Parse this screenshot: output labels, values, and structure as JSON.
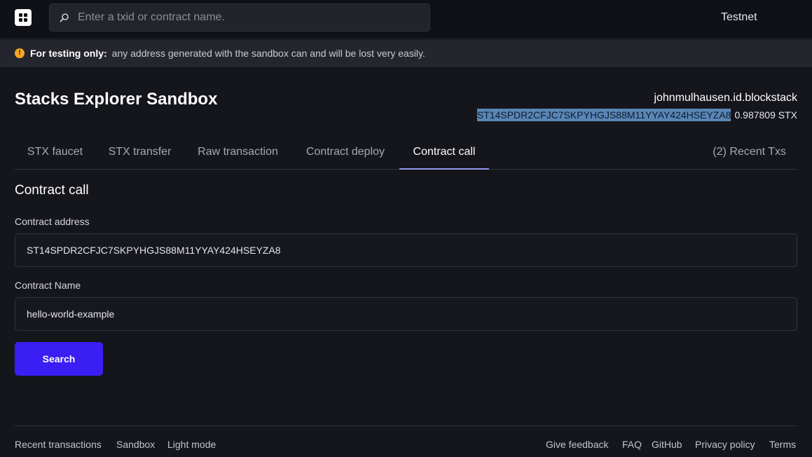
{
  "header": {
    "search_placeholder": "Enter a txid or contract name.",
    "network_label": "Testnet"
  },
  "banner": {
    "bold": "For testing only:",
    "message": "any address generated with the sandbox can and will be lost very easily."
  },
  "page": {
    "title": "Stacks Explorer Sandbox",
    "account_name": "johnmulhausen.id.blockstack",
    "account_address": "ST14SPDR2CFJC7SKPYHGJS88M11YYAY424HSEYZA8",
    "account_balance": "0.987809 STX"
  },
  "tabs": [
    {
      "label": "STX faucet"
    },
    {
      "label": "STX transfer"
    },
    {
      "label": "Raw transaction"
    },
    {
      "label": "Contract deploy"
    },
    {
      "label": "Contract call",
      "active": true
    }
  ],
  "recent_txs": "(2) Recent Txs",
  "form": {
    "section_title": "Contract call",
    "address_label": "Contract address",
    "address_value": "ST14SPDR2CFJC7SKPYHGJS88M11YYAY424HSEYZA8",
    "name_label": "Contract Name",
    "name_value": "hello-world-example",
    "submit_label": "Search"
  },
  "footer": {
    "left": [
      "Recent transactions",
      "Sandbox",
      "Light mode"
    ],
    "right": [
      "Give feedback",
      "FAQ",
      "GitHub",
      "Privacy policy",
      "Terms"
    ]
  },
  "colors": {
    "accent": "#3a1ef3",
    "tab_underline": "#8f97e8",
    "warning": "#f5a524",
    "selection": "#5a86b5"
  }
}
